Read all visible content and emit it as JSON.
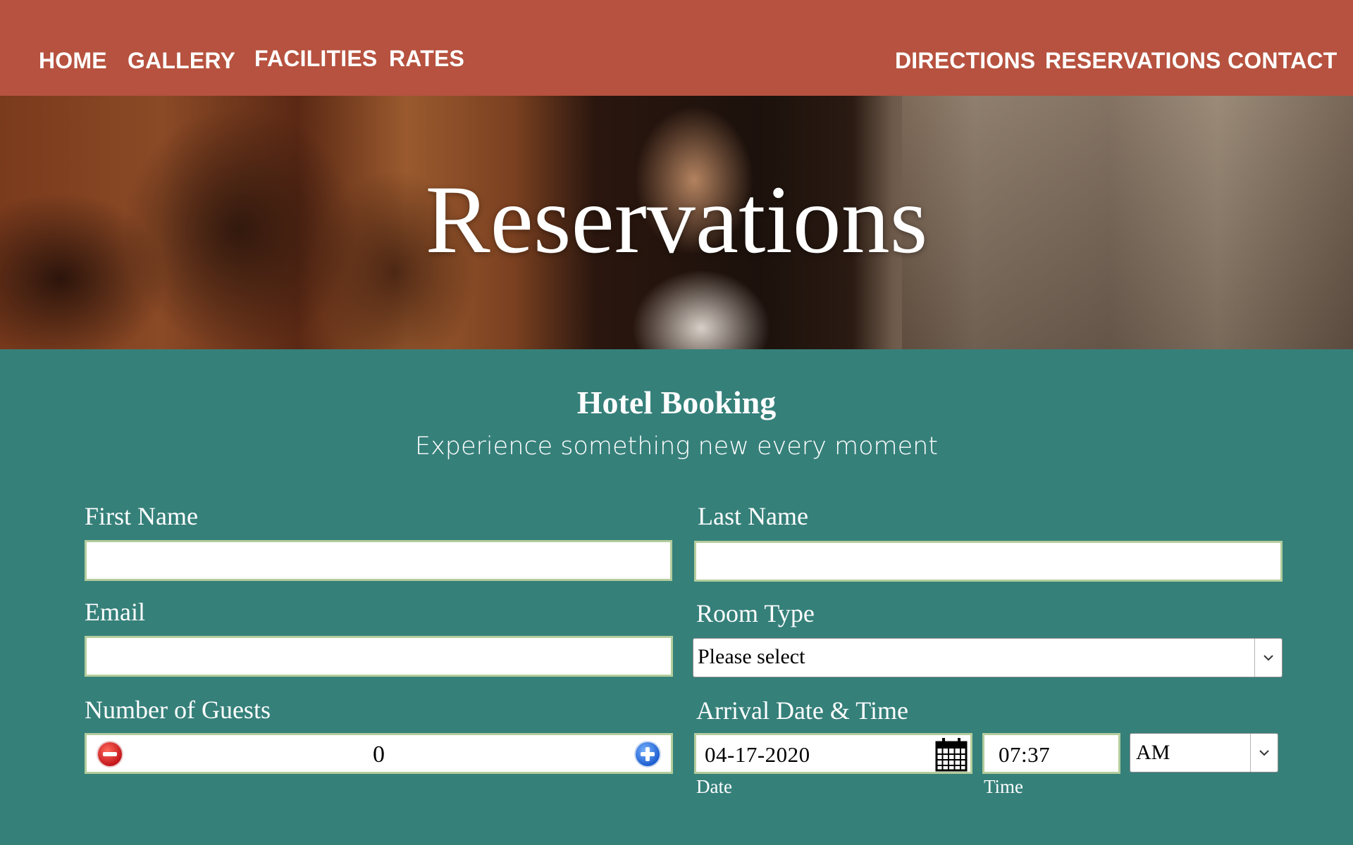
{
  "nav": {
    "left": [
      "HOME",
      "GALLERY",
      "FACILITIES",
      "RATES"
    ],
    "right": [
      "DIRECTIONS",
      "RESERVATIONS",
      "CONTACT"
    ]
  },
  "hero": {
    "title": "Reservations"
  },
  "form": {
    "title": "Hotel Booking",
    "subtitle": "Experience something new every moment",
    "first_name": {
      "label": "First Name",
      "value": ""
    },
    "last_name": {
      "label": "Last Name",
      "value": ""
    },
    "email": {
      "label": "Email",
      "value": ""
    },
    "room_type": {
      "label": "Room Type",
      "selected": "Please select"
    },
    "guests": {
      "label": "Number of Guests",
      "value": "0"
    },
    "arrival": {
      "label": "Arrival Date & Time",
      "date_value": "04-17-2020",
      "date_caption": "Date",
      "time_value": "07:37",
      "time_caption": "Time",
      "ampm_selected": "AM"
    }
  },
  "icons": {
    "minus": "minus-circle-icon",
    "plus": "plus-circle-icon",
    "calendar": "calendar-icon",
    "chevron": "chevron-down-icon"
  },
  "colors": {
    "nav_bg": "#b6523f",
    "page_bg": "#36807a",
    "field_border": "#b4cd9c",
    "text": "#ffffff"
  }
}
